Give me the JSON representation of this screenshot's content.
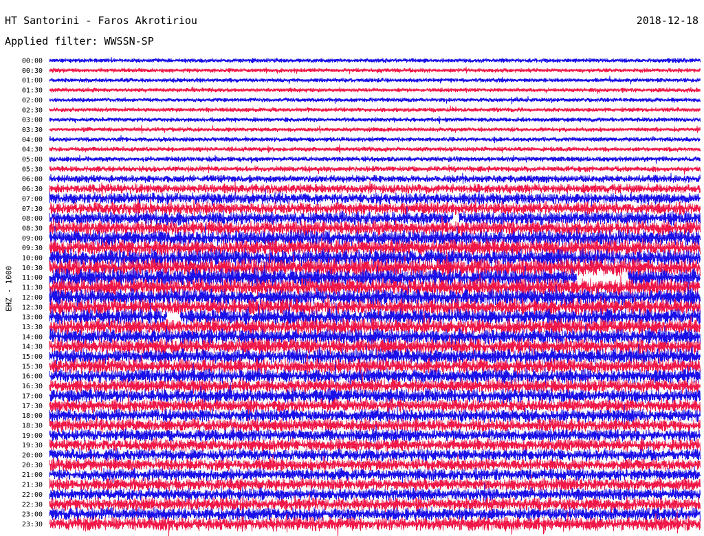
{
  "header": {
    "station_label": "HT Santorini - Faros Akrotiriou",
    "date_label": "2018-12-18",
    "filter_label": "Applied filter: WWSSN-SP"
  },
  "chart_data": {
    "type": "line",
    "title": "HT Santorini - Faros Akrotiriou",
    "subtitle": "Applied filter: WWSSN-SP",
    "date": "2018-12-18",
    "ylabel": "EHZ - 1000",
    "xlabel": "",
    "grid": false,
    "legend": "none",
    "row_interval_minutes": 30,
    "row_labels": [
      "00:00",
      "00:30",
      "01:00",
      "01:30",
      "02:00",
      "02:30",
      "03:00",
      "03:30",
      "04:00",
      "04:30",
      "05:00",
      "05:30",
      "06:00",
      "06:30",
      "07:00",
      "07:30",
      "08:00",
      "08:30",
      "09:00",
      "09:30",
      "10:00",
      "10:30",
      "11:00",
      "11:30",
      "12:00",
      "12:30",
      "13:00",
      "13:30",
      "14:00",
      "14:30",
      "15:00",
      "15:30",
      "16:00",
      "16:30",
      "17:00",
      "17:30",
      "18:00",
      "18:30",
      "19:00",
      "19:30",
      "20:00",
      "20:30",
      "21:00",
      "21:30",
      "22:00",
      "22:30",
      "23:00",
      "23:30"
    ],
    "trace_colors": [
      "#1a10e8",
      "#f01848"
    ],
    "relative_noise_level": [
      0.1,
      0.1,
      0.1,
      0.1,
      0.1,
      0.1,
      0.1,
      0.1,
      0.12,
      0.12,
      0.16,
      0.2,
      0.3,
      0.42,
      0.55,
      0.6,
      0.7,
      0.75,
      0.8,
      0.85,
      0.9,
      0.95,
      0.95,
      0.9,
      0.9,
      0.85,
      0.85,
      0.8,
      0.8,
      0.8,
      0.8,
      0.75,
      0.75,
      0.7,
      0.7,
      0.65,
      0.65,
      0.65,
      0.6,
      0.6,
      0.6,
      0.6,
      0.6,
      0.6,
      0.6,
      0.65,
      0.65,
      0.7
    ],
    "data_gaps": [
      {
        "row": "08:00",
        "start_fraction": 0.62,
        "end_fraction": 0.63
      },
      {
        "row": "11:00",
        "start_fraction": 0.81,
        "end_fraction": 0.89
      },
      {
        "row": "13:00",
        "start_fraction": 0.18,
        "end_fraction": 0.2
      }
    ]
  }
}
